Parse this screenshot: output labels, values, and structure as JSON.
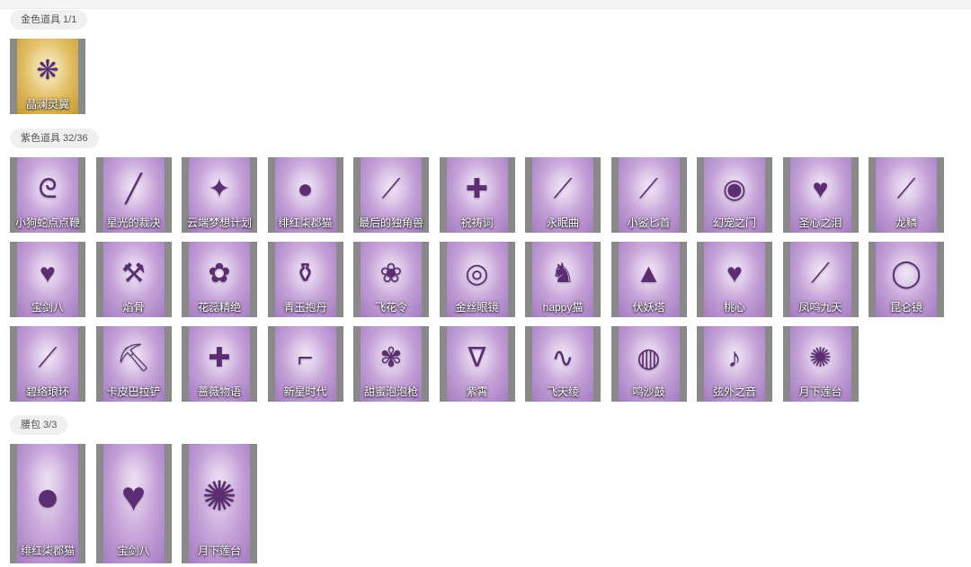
{
  "sections": [
    {
      "title": "金色道具 1/1",
      "items": [
        {
          "label": "晶澜灵翼",
          "icon": "wings-icon",
          "glyph": "❋"
        }
      ]
    },
    {
      "title": "紫色道具 32/36",
      "items": [
        {
          "label": "小狗蛇点点鞭",
          "icon": "whip-icon",
          "glyph": "ᘓ"
        },
        {
          "label": "星光的裁决",
          "icon": "gun-icon",
          "glyph": "╱"
        },
        {
          "label": "云端梦想计划",
          "icon": "mace-icon",
          "glyph": "✦"
        },
        {
          "label": "绯红柒郡猫",
          "icon": "cat-icon",
          "glyph": "●"
        },
        {
          "label": "最后的独角兽",
          "icon": "horn-blade-icon",
          "glyph": "⟋"
        },
        {
          "label": "祝祷词",
          "icon": "cross-pendant-icon",
          "glyph": "✚"
        },
        {
          "label": "永眠曲",
          "icon": "sword-icon",
          "glyph": "⟋"
        },
        {
          "label": "小鲨匕首",
          "icon": "shark-dagger-icon",
          "glyph": "⟋"
        },
        {
          "label": "幻宠之门",
          "icon": "mirror-icon",
          "glyph": "◉"
        },
        {
          "label": "圣心之泪",
          "icon": "heart-wand-icon",
          "glyph": "♥"
        },
        {
          "label": "龙鳞",
          "icon": "golden-spear-icon",
          "glyph": "⟋"
        },
        {
          "label": "宝剑八",
          "icon": "heart-locket-icon",
          "glyph": "♥"
        },
        {
          "label": "焰骨",
          "icon": "hammer-icon",
          "glyph": "⚒"
        },
        {
          "label": "花蕊精绝",
          "icon": "flower-chain-icon",
          "glyph": "✿"
        },
        {
          "label": "青玉抱丹",
          "icon": "vase-icon",
          "glyph": "⚱"
        },
        {
          "label": "飞花令",
          "icon": "bouquet-icon",
          "glyph": "❀"
        },
        {
          "label": "金丝眼镜",
          "icon": "glasses-icon",
          "glyph": "◎"
        },
        {
          "label": "happy猫",
          "icon": "cat-figure-icon",
          "glyph": "♞"
        },
        {
          "label": "伏妖塔",
          "icon": "pagoda-icon",
          "glyph": "▲"
        },
        {
          "label": "桃心",
          "icon": "heart-staff-icon",
          "glyph": "♥"
        },
        {
          "label": "凤鸣九天",
          "icon": "red-blade-icon",
          "glyph": "⟋"
        },
        {
          "label": "昆仑镜",
          "icon": "ring-mirror-icon",
          "glyph": "◯"
        },
        {
          "label": "碧络琅环",
          "icon": "jade-staff-icon",
          "glyph": "⟋"
        },
        {
          "label": "卡皮巴拉铲",
          "icon": "capybara-shovel-icon",
          "glyph": "⛏"
        },
        {
          "label": "蔷薇物语",
          "icon": "medkit-icon",
          "glyph": "✚"
        },
        {
          "label": "新星时代",
          "icon": "revolver-icon",
          "glyph": "⌐"
        },
        {
          "label": "甜蜜泡泡枪",
          "icon": "bubble-gun-icon",
          "glyph": "✾"
        },
        {
          "label": "紫霄",
          "icon": "pendant-icon",
          "glyph": "ᐁ"
        },
        {
          "label": "飞天绫",
          "icon": "ribbon-icon",
          "glyph": "∿"
        },
        {
          "label": "鸣沙鼓",
          "icon": "drum-icon",
          "glyph": "◍"
        },
        {
          "label": "弦外之音",
          "icon": "lute-icon",
          "glyph": "♪"
        },
        {
          "label": "月下莲台",
          "icon": "lotus-mirror-icon",
          "glyph": "✺"
        }
      ]
    },
    {
      "title": "腰包 3/3",
      "items": [
        {
          "label": "绯红柒郡猫",
          "icon": "cat-icon",
          "glyph": "●"
        },
        {
          "label": "宝剑八",
          "icon": "heart-locket-icon",
          "glyph": "♥"
        },
        {
          "label": "月下莲台",
          "icon": "lotus-mirror-icon",
          "glyph": "✺"
        }
      ]
    }
  ]
}
